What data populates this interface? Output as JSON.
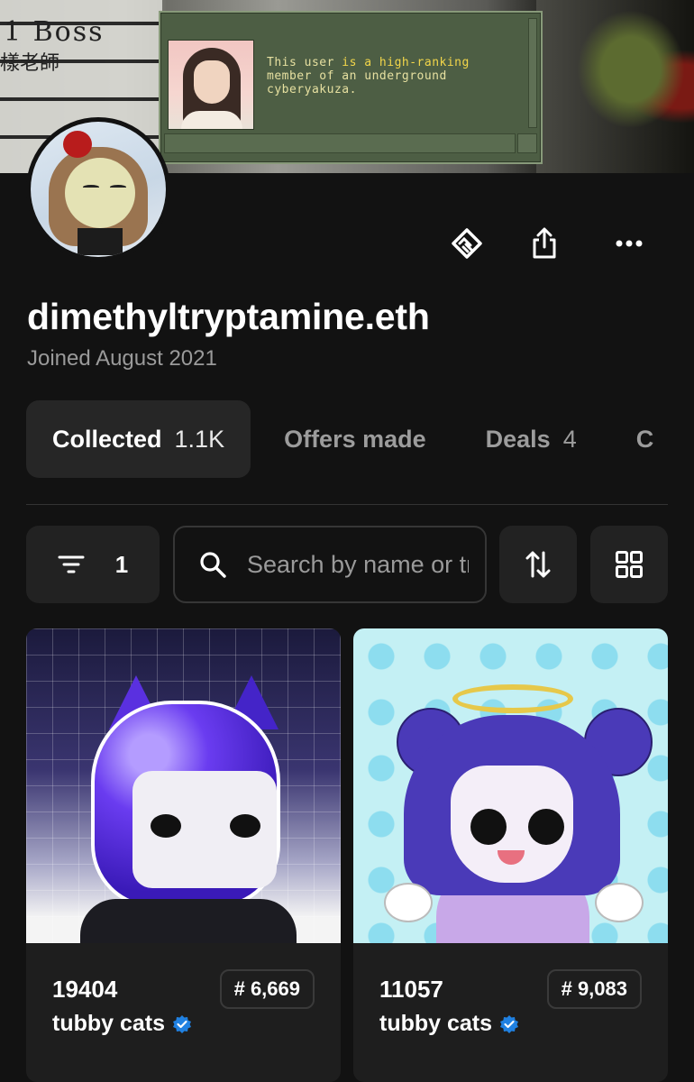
{
  "banner": {
    "sign_text": "1 Boss",
    "sign_text2": "樣老師",
    "dialog_message_pre": "This user ",
    "dialog_message_hl": "is a high-ranking",
    "dialog_message_rest": "member of an underground cyberyakuza."
  },
  "profile": {
    "username": "dimethyltryptamine.eth",
    "joined": "Joined August 2021"
  },
  "actions": {
    "deals_icon": "handshake-icon",
    "share_icon": "share-icon",
    "more_icon": "more-icon"
  },
  "tabs": [
    {
      "label": "Collected",
      "count": "1.1K",
      "active": true
    },
    {
      "label": "Offers made",
      "count": ""
    },
    {
      "label": "Deals",
      "count": "4"
    },
    {
      "label": "C",
      "count": ""
    }
  ],
  "toolbar": {
    "filter_count": "1",
    "search_placeholder": "Search by name or trait",
    "sort_icon": "sort-icon",
    "grid_icon": "grid-icon"
  },
  "cards": [
    {
      "token": "19404",
      "rank": "# 6,669",
      "collection": "tubby cats"
    },
    {
      "token": "11057",
      "rank": "# 9,083",
      "collection": "tubby cats"
    }
  ],
  "colors": {
    "background": "#121212",
    "surface": "#262626",
    "muted_text": "#9a9a9a",
    "verified": "#2081e2"
  }
}
